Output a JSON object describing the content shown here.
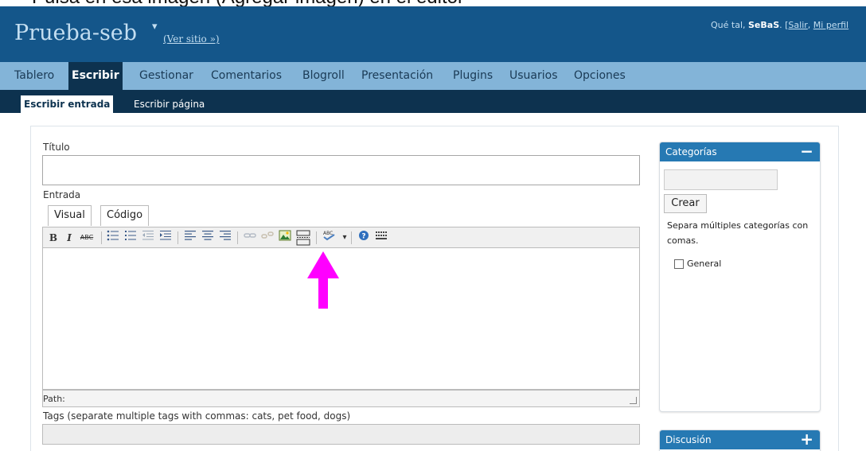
{
  "caption_top": "Pulsa en esa imagen (Agregar imagen) en el editor",
  "header": {
    "site_title": "Prueba-seb",
    "site_caret": "▾",
    "view_site": "(Ver sitio »)",
    "greeting_prefix": "Qué tal, ",
    "username": "SeBaS",
    "greeting_mid": ". [",
    "logout": "Salir",
    "sep": ", ",
    "profile": "Mi perfil"
  },
  "menu": {
    "items": [
      {
        "label": "Tablero"
      },
      {
        "label": "Escribir"
      },
      {
        "label": "Gestionar"
      },
      {
        "label": "Comentarios"
      },
      {
        "label": "Blogroll"
      },
      {
        "label": "Presentación"
      },
      {
        "label": "Plugins"
      },
      {
        "label": "Usuarios"
      },
      {
        "label": "Opciones"
      }
    ]
  },
  "submenu": {
    "items": [
      {
        "label": "Escribir entrada"
      },
      {
        "label": "Escribir página"
      }
    ]
  },
  "form": {
    "title_label": "Título",
    "title_value": "",
    "entry_label": "Entrada",
    "tab_visual": "Visual",
    "tab_code": "Código",
    "path_label": "Path:",
    "tags_label": "Tags (separate multiple tags with commas: cats, pet food, dogs)",
    "tags_value": ""
  },
  "toolbar": {
    "bold": "B",
    "italic": "I",
    "strike": "ABC",
    "spell": "ABC",
    "dropdown": "▾"
  },
  "categories": {
    "title": "Categorías",
    "toggle": "−",
    "input_value": "",
    "create_button": "Crear",
    "help": "Separa múltiples categorías con comas.",
    "items": [
      {
        "label": "General",
        "checked": false
      }
    ]
  },
  "discussion": {
    "title": "Discusión",
    "toggle": "+"
  },
  "colors": {
    "header_bg": "#14568a",
    "menu_bg": "#83b4d8",
    "submenu_bg": "#0d324f",
    "box_head": "#2679b3",
    "annotation_arrow": "#ff00ff"
  }
}
